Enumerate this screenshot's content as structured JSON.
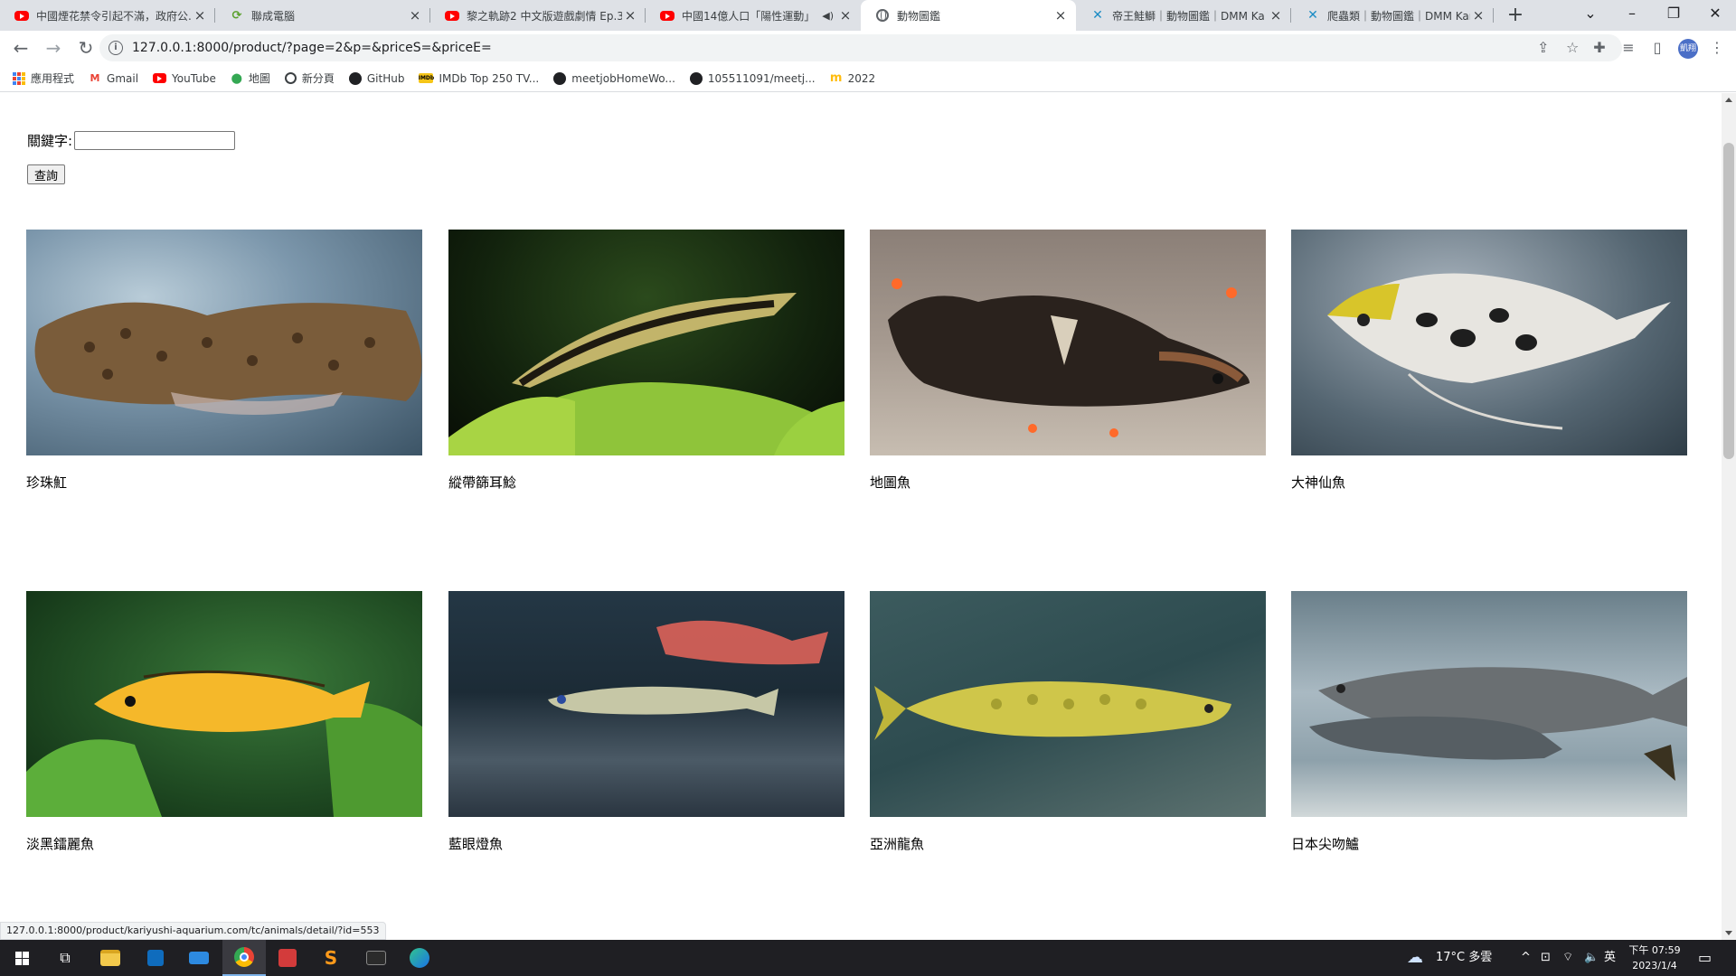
{
  "browser": {
    "tabs": [
      {
        "title": "中國煙花禁令引起不滿，政府公...",
        "favicon": "youtube-icon",
        "active": false
      },
      {
        "title": "聯成電腦",
        "favicon": "lcc-icon",
        "active": false
      },
      {
        "title": "黎之軌跡2 中文版遊戲劇情 Ep.3",
        "favicon": "youtube-icon",
        "active": false
      },
      {
        "title": "中國14億人口「陽性運動」",
        "favicon": "youtube-icon",
        "active": false,
        "audio": true
      },
      {
        "title": "動物圖鑑",
        "favicon": "globe-icon",
        "active": true
      },
      {
        "title": "帝王鮭鰤｜動物圖鑑｜DMM Ka",
        "favicon": "kariyushi-icon",
        "active": false
      },
      {
        "title": "爬蟲類｜動物圖鑑｜DMM Kariy",
        "favicon": "kariyushi-icon",
        "active": false
      }
    ],
    "url": "127.0.0.1:8000/product/?page=2&p=&priceS=&priceE=",
    "avatar_text": "凱翔",
    "bookmarks": [
      {
        "label": "應用程式",
        "icon": "apps-icon"
      },
      {
        "label": "Gmail",
        "icon": "gmail-icon"
      },
      {
        "label": "YouTube",
        "icon": "youtube-icon"
      },
      {
        "label": "地圖",
        "icon": "maps-icon"
      },
      {
        "label": "新分頁",
        "icon": "globe-icon"
      },
      {
        "label": "GitHub",
        "icon": "github-icon"
      },
      {
        "label": "IMDb Top 250 TV...",
        "icon": "imdb-icon"
      },
      {
        "label": "meetjobHomeWo...",
        "icon": "github-icon"
      },
      {
        "label": "105511091/meetj...",
        "icon": "github-icon"
      },
      {
        "label": "2022",
        "icon": "mcdonalds-icon"
      }
    ],
    "status_url": "127.0.0.1:8000/product/kariyushi-aquarium.com/tc/animals/detail/?id=553"
  },
  "page": {
    "search": {
      "label": "關鍵字:",
      "value": "",
      "submit_label": "查詢"
    },
    "products": [
      {
        "name": "珍珠魟"
      },
      {
        "name": "縱帶篩耳鯰"
      },
      {
        "name": "地圖魚"
      },
      {
        "name": "大神仙魚"
      },
      {
        "name": "淡黑鐳麗魚"
      },
      {
        "name": "藍眼燈魚"
      },
      {
        "name": "亞洲龍魚"
      },
      {
        "name": "日本尖吻鱸"
      }
    ]
  },
  "taskbar": {
    "weather": "17°C 多雲",
    "ime": "英",
    "time": "下午 07:59",
    "date": "2023/1/4"
  }
}
